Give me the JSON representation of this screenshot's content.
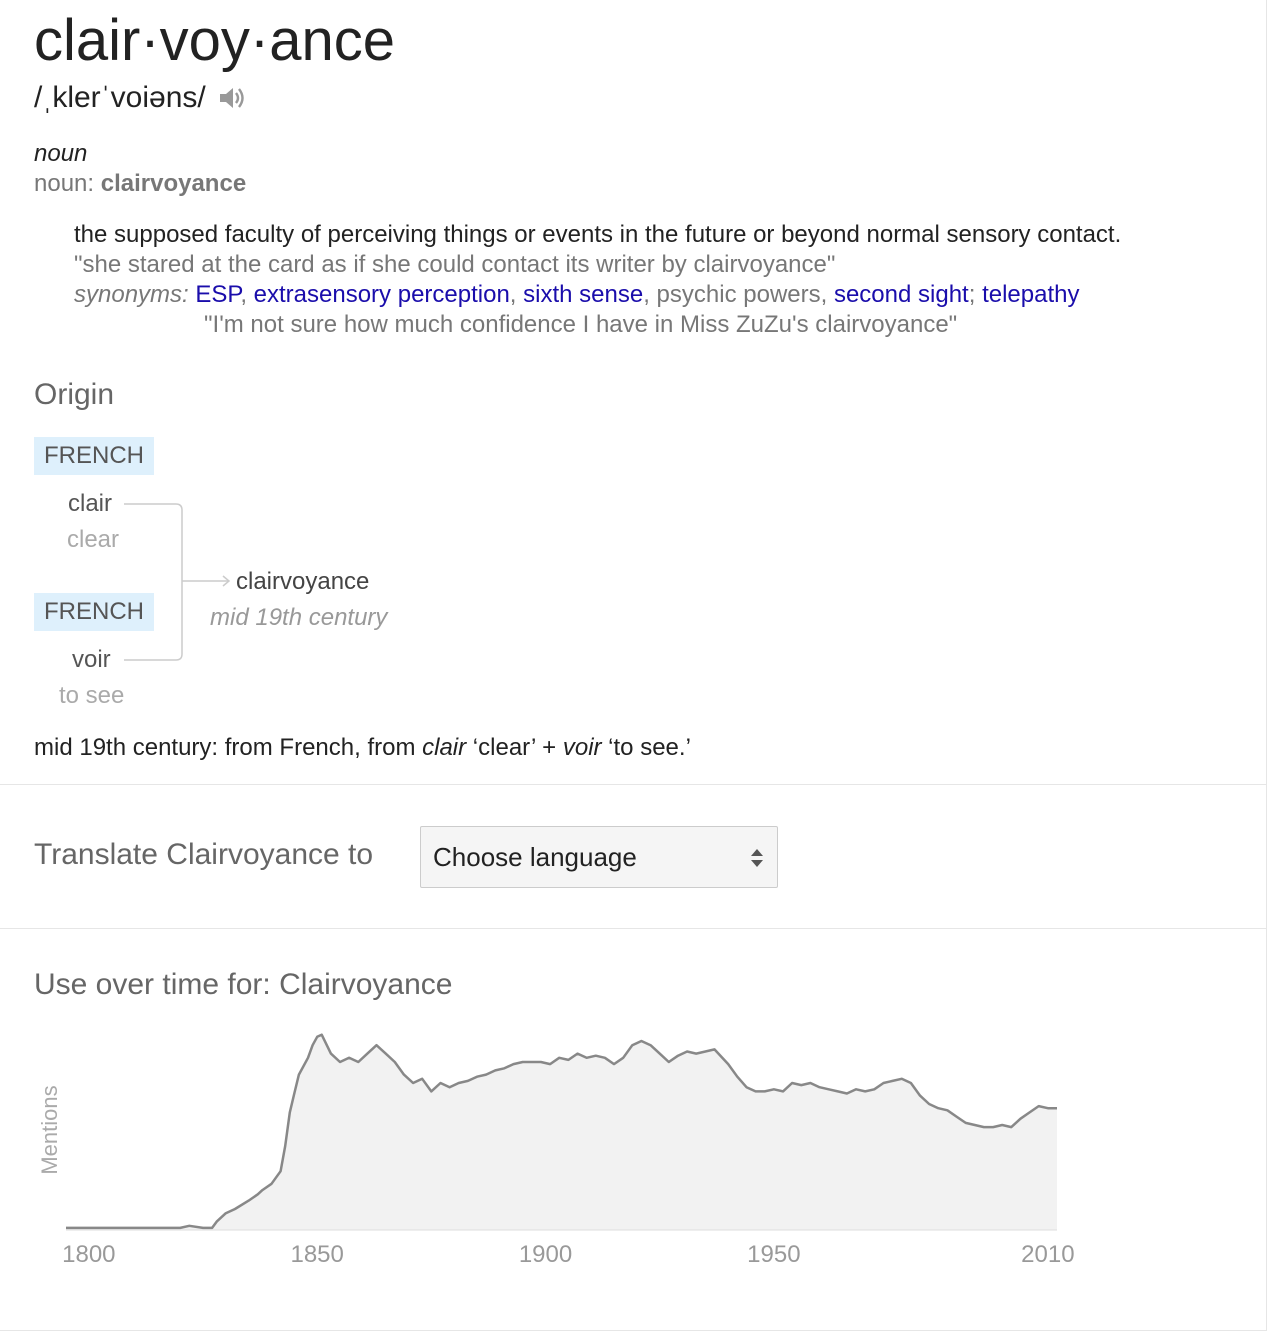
{
  "entry": {
    "headword": "clair·voy·ance",
    "phonetic": "/ˌklerˈvoiəns/",
    "speaker_icon": "speaker-icon",
    "part_of_speech": "noun",
    "pos_prefix": "noun: ",
    "pos_word": "clairvoyance",
    "definition": "the supposed faculty of perceiving things or events in the future or beyond normal sensory contact.",
    "example": "\"she stared at the card as if she could contact its writer by clairvoyance\"",
    "synonyms_label": "synonyms:",
    "synonyms": [
      {
        "text": "ESP",
        "linked": true
      },
      {
        "text": "extrasensory perception",
        "linked": true
      },
      {
        "text": "sixth sense",
        "linked": true
      },
      {
        "text": "psychic powers",
        "linked": false
      },
      {
        "text": "second sight",
        "linked": true
      },
      {
        "text": "telepathy",
        "linked": true
      }
    ],
    "synonym_example": "\"I'm not sure how much confidence I have in Miss ZuZu's clairvoyance\""
  },
  "origin": {
    "title": "Origin",
    "sources": [
      {
        "language": "FRENCH",
        "word": "clair",
        "gloss": "clear"
      },
      {
        "language": "FRENCH",
        "word": "voir",
        "gloss": "to see"
      }
    ],
    "result_word": "clairvoyance",
    "result_date": "mid 19th century",
    "text_1": "mid 19th century: from French, from ",
    "text_word1": "clair",
    "text_2": " ‘clear’ + ",
    "text_word2": "voir",
    "text_3": " ‘to see.’"
  },
  "translate": {
    "label": "Translate Clairvoyance to",
    "selected": "Choose language"
  },
  "usage": {
    "title": "Use over time for: Clairvoyance"
  },
  "chart_data": {
    "type": "area",
    "ylabel": "Mentions",
    "x_ticks": [
      "1800",
      "1850",
      "1900",
      "1950",
      "2010"
    ],
    "xlim": [
      1795,
      2012
    ],
    "ylim": [
      0,
      100
    ],
    "grid": false,
    "x": [
      1795,
      1805,
      1815,
      1820,
      1822,
      1825,
      1827,
      1828,
      1830,
      1832,
      1835,
      1837,
      1838,
      1840,
      1842,
      1843,
      1844,
      1845,
      1846,
      1848,
      1849,
      1850,
      1851,
      1853,
      1855,
      1857,
      1859,
      1861,
      1863,
      1865,
      1867,
      1869,
      1871,
      1873,
      1875,
      1877,
      1879,
      1881,
      1883,
      1885,
      1887,
      1889,
      1891,
      1893,
      1895,
      1897,
      1899,
      1901,
      1903,
      1905,
      1907,
      1909,
      1911,
      1913,
      1915,
      1917,
      1919,
      1921,
      1923,
      1925,
      1927,
      1929,
      1931,
      1933,
      1935,
      1937,
      1940,
      1942,
      1944,
      1946,
      1948,
      1950,
      1952,
      1954,
      1956,
      1958,
      1960,
      1962,
      1964,
      1966,
      1968,
      1970,
      1972,
      1974,
      1976,
      1978,
      1980,
      1982,
      1984,
      1986,
      1988,
      1990,
      1992,
      1994,
      1996,
      1998,
      2000,
      2002,
      2004,
      2006,
      2008,
      2010,
      2012
    ],
    "y": [
      1,
      1,
      1,
      1,
      2,
      1,
      1,
      4,
      8,
      10,
      14,
      17,
      19,
      22,
      28,
      40,
      56,
      65,
      74,
      82,
      88,
      92,
      93,
      84,
      80,
      82,
      80,
      84,
      88,
      84,
      80,
      74,
      70,
      72,
      66,
      70,
      68,
      70,
      71,
      73,
      74,
      76,
      77,
      79,
      80,
      80,
      80,
      79,
      82,
      81,
      84,
      82,
      83,
      82,
      79,
      82,
      88,
      90,
      88,
      84,
      80,
      83,
      85,
      84,
      85,
      86,
      79,
      73,
      68,
      66,
      66,
      67,
      66,
      70,
      69,
      70,
      68,
      67,
      66,
      65,
      67,
      66,
      67,
      70,
      71,
      72,
      70,
      64,
      60,
      58,
      57,
      54,
      51,
      50,
      49,
      49,
      50,
      49,
      53,
      56,
      59,
      58,
      58,
      60,
      59,
      59
    ]
  }
}
